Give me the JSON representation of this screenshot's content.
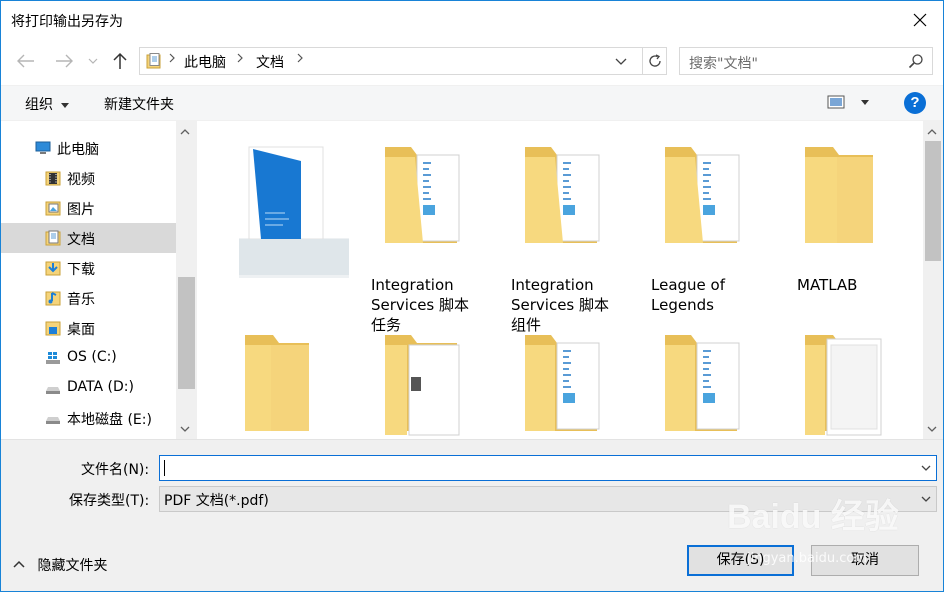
{
  "window": {
    "title": "将打印输出另存为",
    "colors": {
      "accent": "#0a6fd6",
      "folder": "#f5d47b",
      "selected": "#d9d9d9"
    }
  },
  "nav": {
    "breadcrumb": [
      "此电脑",
      "文档"
    ],
    "search_placeholder": "搜索\"文档\""
  },
  "toolbar": {
    "organize_label": "组织",
    "new_folder_label": "新建文件夹",
    "help_label": "?"
  },
  "sidebar": {
    "root": "此电脑",
    "items": [
      {
        "label": "视频",
        "icon": "video-folder-icon"
      },
      {
        "label": "图片",
        "icon": "pictures-folder-icon"
      },
      {
        "label": "文档",
        "icon": "documents-folder-icon",
        "selected": true
      },
      {
        "label": "下载",
        "icon": "downloads-folder-icon"
      },
      {
        "label": "音乐",
        "icon": "music-folder-icon"
      },
      {
        "label": "桌面",
        "icon": "desktop-folder-icon"
      },
      {
        "label": "OS (C:)",
        "icon": "windows-drive-icon"
      },
      {
        "label": "DATA (D:)",
        "icon": "drive-icon"
      },
      {
        "label": "本地磁盘 (E:)",
        "icon": "drive-icon"
      }
    ]
  },
  "content": {
    "folders": [
      {
        "label": "",
        "type": "image-folder"
      },
      {
        "label": "Integration Services 脚本任务",
        "type": "doc-folder"
      },
      {
        "label": "Integration Services 脚本组件",
        "type": "doc-folder"
      },
      {
        "label": "League of Legends",
        "type": "doc-folder"
      },
      {
        "label": "MATLAB",
        "type": "empty-folder"
      },
      {
        "label": "",
        "type": "empty-folder"
      },
      {
        "label": "",
        "type": "file-folder"
      },
      {
        "label": "",
        "type": "doc-folder"
      },
      {
        "label": "",
        "type": "doc-folder"
      },
      {
        "label": "",
        "type": "paper-folder"
      }
    ]
  },
  "form": {
    "filename_label": "文件名(N):",
    "filename_value": "",
    "filetype_label": "保存类型(T):",
    "filetype_value": "PDF 文档(*.pdf)",
    "hide_folders_label": "隐藏文件夹",
    "save_label": "保存(S)",
    "cancel_label": "取消"
  },
  "watermark": {
    "brand": "Baidu 经验",
    "url": "jingyan.baidu.com"
  }
}
